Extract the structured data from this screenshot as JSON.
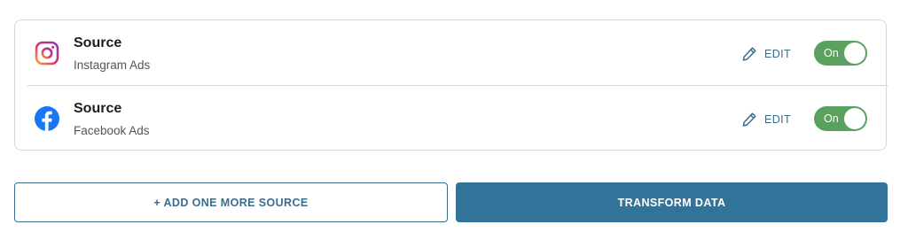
{
  "sources": [
    {
      "title": "Source",
      "subtitle": "Instagram Ads",
      "icon": "instagram-icon",
      "edit_label": "EDIT",
      "toggle_label": "On",
      "enabled": true
    },
    {
      "title": "Source",
      "subtitle": "Facebook Ads",
      "icon": "facebook-icon",
      "edit_label": "EDIT",
      "toggle_label": "On",
      "enabled": true
    }
  ],
  "actions": {
    "add_source_label": "+ ADD ONE MORE SOURCE",
    "transform_label": "TRANSFORM DATA"
  },
  "colors": {
    "accent": "#32739a",
    "toggle_on": "#5aa05f",
    "facebook_blue": "#1877f2",
    "border": "#d8d8d8"
  }
}
